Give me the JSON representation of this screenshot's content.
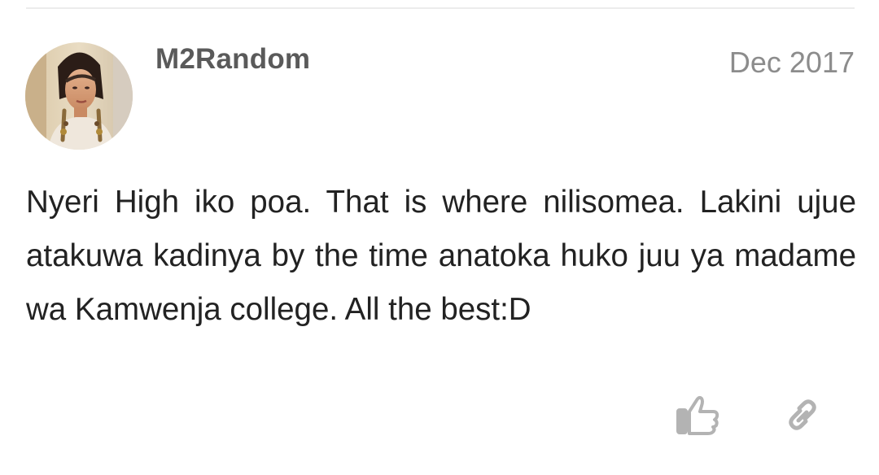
{
  "post": {
    "author": {
      "username": "M2Random",
      "avatar_icon": "user-avatar-photo"
    },
    "date": "Dec 2017",
    "body": "Nyeri High iko poa. That is where nilisomea. Lakini ujue atakuwa kadinya by the time anatoka huko juu ya madame wa Kamwenja college. All the best:D",
    "actions": {
      "like_icon": "thumbs-up-icon",
      "link_icon": "link-icon"
    }
  },
  "colors": {
    "username": "#5a5a5a",
    "date": "#8c8c8c",
    "body_text": "#222222",
    "icon": "#b3b3b3",
    "divider": "#ececec"
  }
}
